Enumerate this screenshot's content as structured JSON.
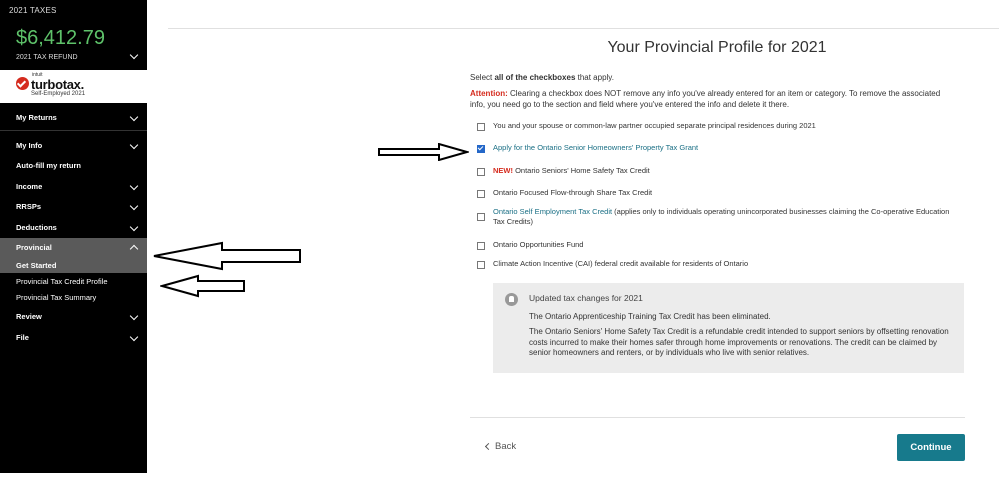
{
  "sidebar": {
    "tax_year": "2021 TAXES",
    "refund_amount": "$6,412.79",
    "refund_label": "2021 TAX REFUND",
    "logo": {
      "intuit": "intuit",
      "brand": "turbotax.",
      "edition": "Self-Employed 2021"
    },
    "nav": {
      "my_returns": "My Returns",
      "my_info": "My Info",
      "auto_fill": "Auto-fill my return",
      "income": "Income",
      "rrsps": "RRSPs",
      "deductions": "Deductions",
      "provincial": "Provincial",
      "get_started": "Get Started",
      "credit_profile": "Provincial Tax Credit Profile",
      "tax_summary": "Provincial Tax Summary",
      "review": "Review",
      "file": "File"
    }
  },
  "main": {
    "title": "Your Provincial Profile for 2021",
    "intro_pre": "Select ",
    "intro_bold": "all of the checkboxes",
    "intro_post": " that apply.",
    "attention_label": "Attention:",
    "attention_text": " Clearing a checkbox does NOT remove any info you've already entered for an item or category. To remove the associated info, you need go to the section and field where you've entered the info and delete it there.",
    "options": {
      "o1": "You and your spouse or common-law partner occupied separate principal residences during 2021",
      "o2": "Apply for the Ontario Senior Homeowners' Property Tax Grant",
      "o3_new": "NEW!",
      "o3": " Ontario Seniors' Home Safety Tax Credit",
      "o4": "Ontario Focused Flow-through Share Tax Credit",
      "o5_link": "Ontario Self Employment Tax Credit",
      "o5": " (applies only to individuals operating unincorporated businesses claiming the Co-operative Education Tax Credits)",
      "o6": "Ontario Opportunities Fund",
      "o7": "Climate Action Incentive (CAI) federal credit available for residents of Ontario"
    },
    "checked": [
      false,
      true,
      false,
      false,
      false,
      false,
      false
    ],
    "info": {
      "title": "Updated tax changes for 2021",
      "p1": "The Ontario Apprenticeship Training Tax Credit has been eliminated.",
      "p2": "The Ontario Seniors' Home Safety Tax Credit is a refundable credit intended to support seniors by offsetting renovation costs incurred to make their homes safer through home improvements or renovations. The credit can be claimed by senior homeowners and renters, or by individuals who live with senior relatives."
    },
    "back_label": "Back",
    "continue_label": "Continue"
  },
  "colors": {
    "accent": "#177a8c",
    "refund": "#5ec26a",
    "attention": "#d52b1e",
    "sidebar_bg": "#000000",
    "selected_nav": "#5a5a5a"
  }
}
